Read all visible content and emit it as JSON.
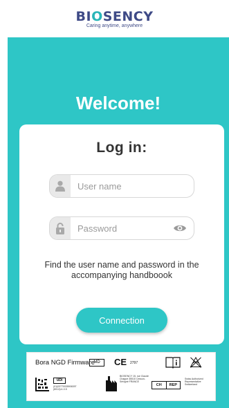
{
  "header": {
    "brand_prefix": "BI",
    "brand_accent": "O",
    "brand_suffix": "SENCY",
    "tagline": "Caring anytime, anywhere"
  },
  "welcome": "Welcome!",
  "login": {
    "title": "Log in:",
    "username_placeholder": "User name",
    "password_placeholder": "Password",
    "hint": "Find the user name and password in the accompanying handboook",
    "button_label": "Connection"
  },
  "label": {
    "product_name": "Bora NGD Firmware",
    "md_symbol": "MD",
    "ce_mark": "CE",
    "ce_number": "2797",
    "udi_label": "UDI",
    "udi_code": "(01)03770035906397 (8012)v1.0.5",
    "manufacturer_address": "BIOSENCY 15, rue Claude Chappe 35510 Cesson-Sévigné FRANCE",
    "ch_label": "CH",
    "rep_label": "REP",
    "ch_rep_address": "Swiss Authorized Representative Switzerland"
  },
  "colors": {
    "teal": "#2ec6c6",
    "brand_navy": "#3e4a86",
    "brand_teal": "#2ab6b8"
  },
  "icons": {
    "user_field": "person-icon",
    "password_field": "padlock-icon",
    "show_password": "eye-icon",
    "manual": "instructions-for-use-icon",
    "no_wifi": "wireless-crossed-icon",
    "manufacturer": "factory-icon",
    "udi_matrix": "data-matrix-icon"
  }
}
